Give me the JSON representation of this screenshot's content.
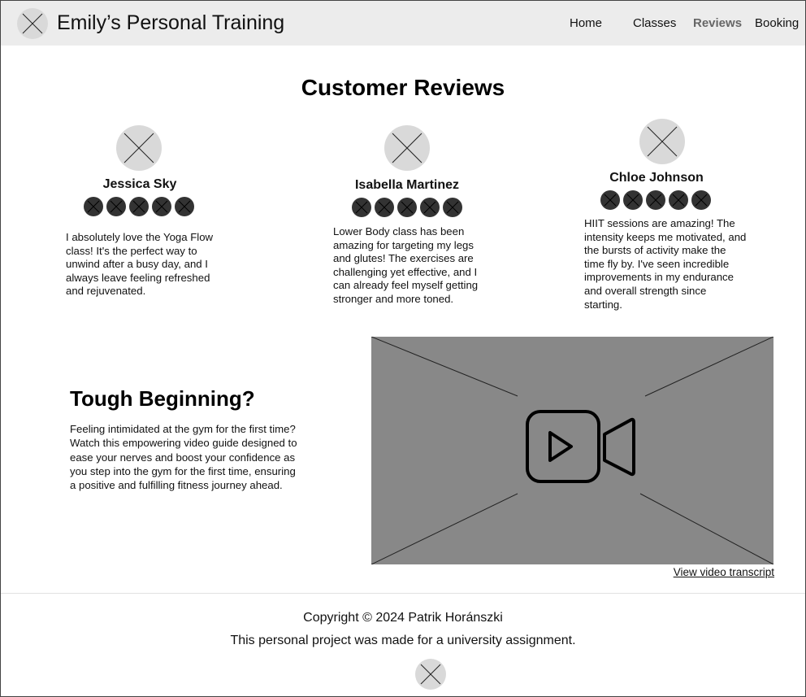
{
  "header": {
    "site_title": "Emily’s Personal Training",
    "logo_icon": "image-placeholder-icon",
    "nav": [
      {
        "label": "Home",
        "active": false
      },
      {
        "label": "Classes",
        "active": false
      },
      {
        "label": "Reviews",
        "active": true
      },
      {
        "label": "Booking",
        "active": false
      }
    ]
  },
  "reviews": {
    "title": "Customer Reviews",
    "items": [
      {
        "name": "Jessica Sky",
        "rating": 5,
        "text": "I absolutely love the Yoga Flow class! It's the perfect way to unwind after a busy day, and I always leave feeling refreshed and rejuvenated."
      },
      {
        "name": "Isabella Martinez",
        "rating": 5,
        "text": "Lower Body class has been amazing for targeting my legs and glutes! The exercises are challenging yet effective, and I can already feel myself getting stronger and more toned."
      },
      {
        "name": "Chloe Johnson",
        "rating": 5,
        "text": "HIIT sessions are amazing! The intensity keeps me motivated, and the bursts of activity make the time fly by. I've seen incredible improvements in my endurance and overall strength since starting."
      }
    ]
  },
  "promo": {
    "title": "Tough Beginning?",
    "text": "Feeling intimidated at the gym for the first time? Watch this  empowering video guide designed to ease your nerves and boost your confidence as you step into the gym for the first time, ensuring a positive and fulfilling fitness journey ahead.",
    "video_icon": "video-camera-play-icon",
    "transcript_link": "View video transcript"
  },
  "footer": {
    "copyright": "Copyright © 2024 Patrik Horánszki",
    "note": "This personal project was made for a university assignment.",
    "logo_icon": "image-placeholder-icon"
  },
  "colors": {
    "header_bg": "#ececec",
    "placeholder": "#d9d9d9",
    "star": "#333333",
    "video_bg": "#888888",
    "active_nav": "#666666"
  }
}
